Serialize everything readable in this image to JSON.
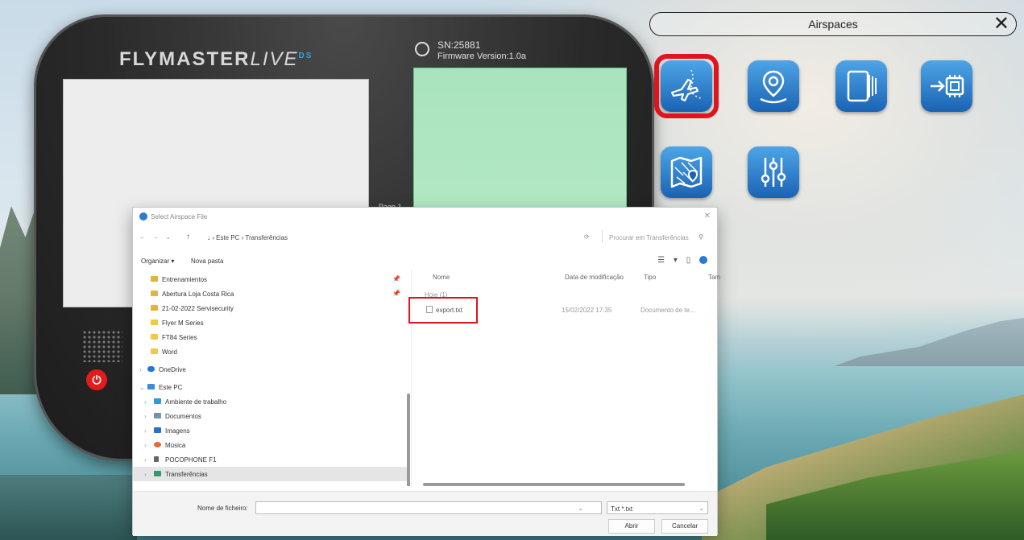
{
  "device": {
    "brand": "FLYMASTER",
    "brand_italic": "LIVE",
    "brand_sup": "DS",
    "serial": "SN:25881",
    "firmware": "Firmware Version:1.0a",
    "page_label": "Page 1",
    "power_glyph": "⏻"
  },
  "panel": {
    "title": "Airspaces",
    "close_glyph": "✕",
    "tiles": [
      {
        "name": "airspace-icon"
      },
      {
        "name": "location-pin-icon"
      },
      {
        "name": "pages-icon"
      },
      {
        "name": "firmware-chip-icon"
      },
      {
        "name": "map-icon"
      },
      {
        "name": "settings-sliders-icon"
      }
    ],
    "colors": {
      "tile": "#1f6fc2",
      "selected": "#e1141e"
    }
  },
  "dialog": {
    "title": "Select Airspace File",
    "close": "✕",
    "nav_arrows": "← → ⌄",
    "up": "↑",
    "breadcrumb": "↓  ›  Este PC  ›  Transferências",
    "refresh": "⟳",
    "search_placeholder": "Procurar em Transferências",
    "search_icon": "⚲",
    "organize": "Organizar ▾",
    "new_folder": "Nova pasta",
    "views": "☰ ▾  ▯",
    "nav_items": [
      {
        "label": "Entrenamientos",
        "pinned": "📌"
      },
      {
        "label": "Abertura Loja Costa Rica",
        "pinned": "📌"
      },
      {
        "label": "21-02-2022 Servisecurity"
      },
      {
        "label": "Flyer M Series"
      },
      {
        "label": "FT84 Series"
      },
      {
        "label": "Word"
      },
      {
        "label": "OneDrive"
      },
      {
        "label": "Este PC"
      },
      {
        "label": "Ambiente de trabalho"
      },
      {
        "label": "Documentos"
      },
      {
        "label": "Imagens"
      },
      {
        "label": "Música"
      },
      {
        "label": "POCOPHONE F1"
      },
      {
        "label": "Transferências"
      }
    ],
    "columns": {
      "name": "Nome",
      "date": "Data de modificação",
      "type": "Tipo",
      "size": "Tam"
    },
    "group": "Hoje (1)",
    "file": {
      "name": "export.txt",
      "date": "15/02/2022 17:35",
      "type": "Documento de te..."
    },
    "filename_label": "Nome de ficheiro:",
    "filename_value": "",
    "filetype": "Txt *.txt",
    "open": "Abrir",
    "cancel": "Cancelar"
  }
}
